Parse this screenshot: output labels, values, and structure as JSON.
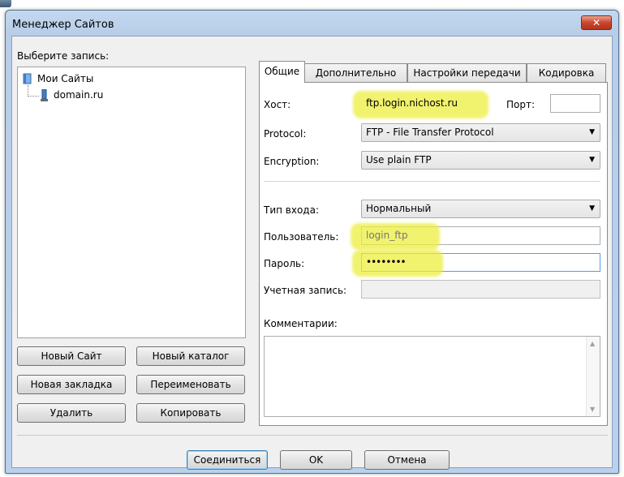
{
  "window": {
    "title": "Менеджер Сайтов",
    "close_glyph": "✕"
  },
  "left": {
    "select_label": "Выберите запись:",
    "tree": {
      "root": "Мои Сайты",
      "child": "domain.ru"
    },
    "buttons": {
      "new_site": "Новый Сайт",
      "new_folder": "Новый каталог",
      "new_bookmark": "Новая закладка",
      "rename": "Переименовать",
      "delete": "Удалить",
      "copy": "Копировать"
    }
  },
  "tabs": [
    "Общие",
    "Дополнительно",
    "Настройки передачи",
    "Кодировка"
  ],
  "general": {
    "host_label": "Хост:",
    "host_value": "ftp.login.nichost.ru",
    "port_label": "Порт:",
    "port_value": "",
    "protocol_label": "Protocol:",
    "protocol_value": "FTP - File Transfer Protocol",
    "encryption_label": "Encryption:",
    "encryption_value": "Use plain FTP",
    "login_type_label": "Тип входа:",
    "login_type_value": "Нормальный",
    "user_label": "Пользователь:",
    "user_value": "login_ftp",
    "password_label": "Пароль:",
    "password_value": "••••••••",
    "account_label": "Учетная запись:",
    "account_value": "",
    "comments_label": "Комментарии:",
    "comments_value": ""
  },
  "footer": {
    "connect": "Соединиться",
    "ok": "OK",
    "cancel": "Отмена"
  },
  "colors": {
    "highlight": "#ecee3c",
    "title_bar": "#b9d1ec",
    "close": "#c9452c"
  }
}
